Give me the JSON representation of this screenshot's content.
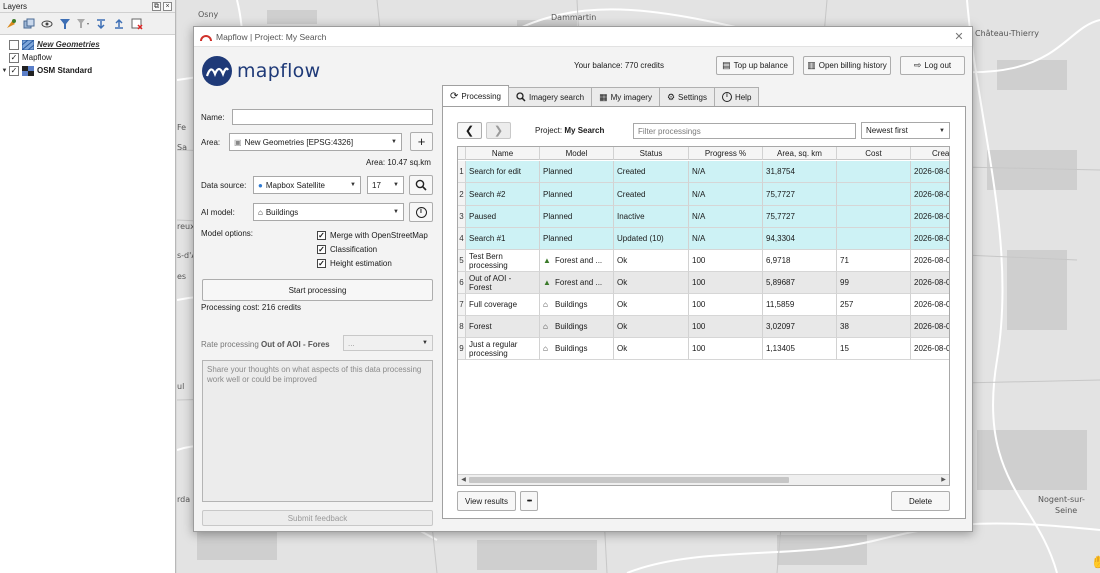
{
  "layers_panel": {
    "title": "Layers",
    "items": [
      {
        "name": "New Geometries",
        "checked": false,
        "style": "italic"
      },
      {
        "name": "Mapflow",
        "checked": true,
        "style": "normal"
      },
      {
        "name": "OSM Standard",
        "checked": true,
        "style": "bold"
      }
    ]
  },
  "map": {
    "labels": [
      "Osny",
      "Dammartin",
      "Château-Thierry",
      "Nogent-sur-",
      "Seine",
      "reux",
      "s-d'A",
      "es",
      "Fe",
      "Sa",
      "ul",
      "rda"
    ]
  },
  "dialog": {
    "title": "Mapflow | Project: My Search",
    "logo_text": "mapflow",
    "balance": "Your balance: 770 credits",
    "top_up_label": "Top up balance",
    "billing_label": "Open billing history",
    "logout_label": "Log out",
    "name_label": "Name:",
    "name_value": "",
    "area_label": "Area:",
    "area_value": "New Geometries [EPSG:4326]",
    "area_size": "Area: 10.47 sq.km",
    "datasource_label": "Data source:",
    "datasource_value": "Mapbox Satellite",
    "zoom_value": "17",
    "ai_model_label": "AI model:",
    "ai_model_value": "Buildings",
    "model_options_label": "Model options:",
    "options": [
      {
        "label": "Merge with OpenStreetMap",
        "checked": true
      },
      {
        "label": "Classification",
        "checked": true
      },
      {
        "label": "Height estimation",
        "checked": true
      }
    ],
    "start_label": "Start processing",
    "cost_label": "Processing cost: 216 credits",
    "rate_prefix": "Rate processing ",
    "rate_target": "Out of AOI - Fores",
    "rate_value": "...",
    "feedback_placeholder": "Share your thoughts on what aspects of this data processing work well or could be improved",
    "submit_label": "Submit feedback"
  },
  "tabs": [
    {
      "label": "Processing",
      "icon": "refresh-icon",
      "active": true
    },
    {
      "label": "Imagery search",
      "icon": "search-icon",
      "active": false
    },
    {
      "label": "My imagery",
      "icon": "image-icon",
      "active": false
    },
    {
      "label": "Settings",
      "icon": "settings-icon",
      "active": false
    },
    {
      "label": "Help",
      "icon": "info-icon",
      "active": false
    }
  ],
  "processing": {
    "project_prefix": "Project:",
    "project_name": "My Search",
    "filter_placeholder": "Filter processings",
    "sort_value": "Newest first",
    "columns": [
      "Name",
      "Model",
      "Status",
      "Progress %",
      "Area, sq. km",
      "Cost",
      "Crea"
    ],
    "rows": [
      {
        "num": "1",
        "name": "Search for edit",
        "model": "Planned",
        "model_icon": "",
        "status": "Created",
        "progress": "N/A",
        "area": "31,8754",
        "cost": "",
        "created": "2026-08-0",
        "tone": "cyan"
      },
      {
        "num": "2",
        "name": "Search #2",
        "model": "Planned",
        "model_icon": "",
        "status": "Created",
        "progress": "N/A",
        "area": "75,7727",
        "cost": "",
        "created": "2026-08-0",
        "tone": "cyan"
      },
      {
        "num": "3",
        "name": "Paused",
        "model": "Planned",
        "model_icon": "",
        "status": "Inactive",
        "progress": "N/A",
        "area": "75,7727",
        "cost": "",
        "created": "2026-08-0",
        "tone": "cyan"
      },
      {
        "num": "4",
        "name": "Search #1",
        "model": "Planned",
        "model_icon": "",
        "status": "Updated (10)",
        "progress": "N/A",
        "area": "94,3304",
        "cost": "",
        "created": "2026-08-0",
        "tone": "cyan"
      },
      {
        "num": "5",
        "name": "Test Bern processing",
        "model": "Forest and ...",
        "model_icon": "tree-icon",
        "status": "Ok",
        "progress": "100",
        "area": "6,9718",
        "cost": "71",
        "created": "2026-08-0",
        "tone": "white"
      },
      {
        "num": "6",
        "name": "Out of AOI - Forest",
        "model": "Forest and ...",
        "model_icon": "tree-icon",
        "status": "Ok",
        "progress": "100",
        "area": "5,89687",
        "cost": "99",
        "created": "2026-08-0",
        "tone": "gray"
      },
      {
        "num": "7",
        "name": "Full coverage",
        "model": "Buildings",
        "model_icon": "building-icon",
        "status": "Ok",
        "progress": "100",
        "area": "11,5859",
        "cost": "257",
        "created": "2026-08-0",
        "tone": "white"
      },
      {
        "num": "8",
        "name": "Forest",
        "model": "Buildings",
        "model_icon": "building-icon",
        "status": "Ok",
        "progress": "100",
        "area": "3,02097",
        "cost": "38",
        "created": "2026-08-0",
        "tone": "gray"
      },
      {
        "num": "9",
        "name": "Just a regular processing",
        "model": "Buildings",
        "model_icon": "building-icon",
        "status": "Ok",
        "progress": "100",
        "area": "1,13405",
        "cost": "15",
        "created": "2026-08-0",
        "tone": "white"
      }
    ],
    "view_results_label": "View results",
    "more_label": "•••",
    "delete_label": "Delete"
  },
  "colors": {
    "brand": "#1f3a78",
    "row_cyan": "#cdf2f5",
    "row_gray": "#e8e8e8"
  }
}
